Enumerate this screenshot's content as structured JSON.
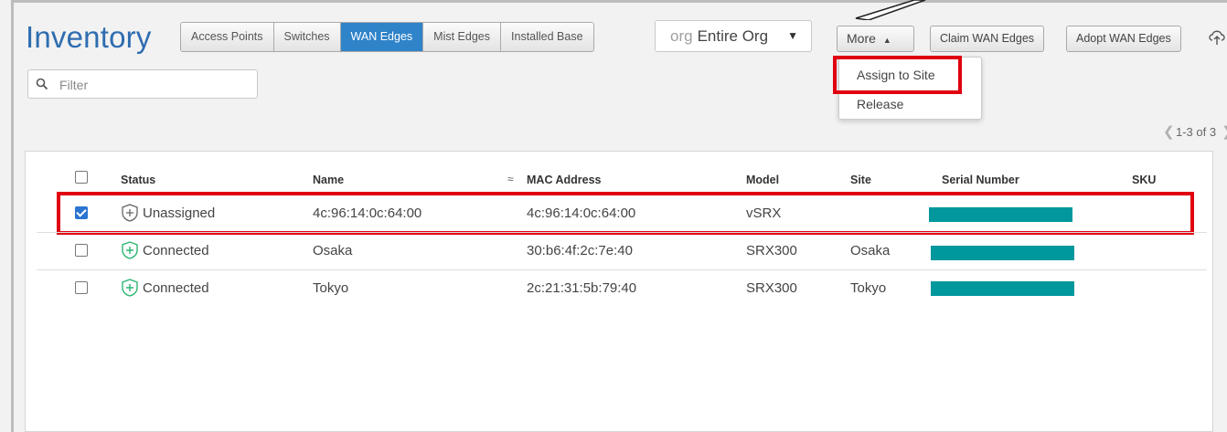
{
  "page": {
    "title": "Inventory"
  },
  "tabs": [
    {
      "label": "Access Points",
      "active": false
    },
    {
      "label": "Switches",
      "active": false
    },
    {
      "label": "WAN Edges",
      "active": true
    },
    {
      "label": "Mist Edges",
      "active": false
    },
    {
      "label": "Installed Base",
      "active": false
    }
  ],
  "org_selector": {
    "prefix": "org",
    "value": "Entire Org"
  },
  "toolbar": {
    "more_label": "More",
    "claim_label": "Claim WAN Edges",
    "adopt_label": "Adopt WAN Edges",
    "cloud_icon": "cloud-upload-icon"
  },
  "filter": {
    "placeholder": "Filter"
  },
  "more_menu": {
    "items": [
      "Assign to Site",
      "Release"
    ]
  },
  "pagination": {
    "text": "1-3 of 3"
  },
  "table": {
    "columns": [
      "Status",
      "Name",
      "MAC Address",
      "Model",
      "Site",
      "Serial Number",
      "SKU"
    ],
    "rows": [
      {
        "checked": true,
        "status": "Unassigned",
        "name": "4c:96:14:0c:64:00",
        "mac": "4c:96:14:0c:64:00",
        "model": "vSRX",
        "site": "",
        "sku": ""
      },
      {
        "checked": false,
        "status": "Connected",
        "name": "Osaka",
        "mac": "30:b6:4f:2c:7e:40",
        "model": "SRX300",
        "site": "Osaka",
        "sku": ""
      },
      {
        "checked": false,
        "status": "Connected",
        "name": "Tokyo",
        "mac": "2c:21:31:5b:79:40",
        "model": "SRX300",
        "site": "Tokyo",
        "sku": ""
      }
    ]
  },
  "colors": {
    "accent": "#2f83c9",
    "title": "#2f6db0",
    "highlight": "#e0000f",
    "serial_redaction": "#00979d",
    "connected": "#2bb673"
  }
}
